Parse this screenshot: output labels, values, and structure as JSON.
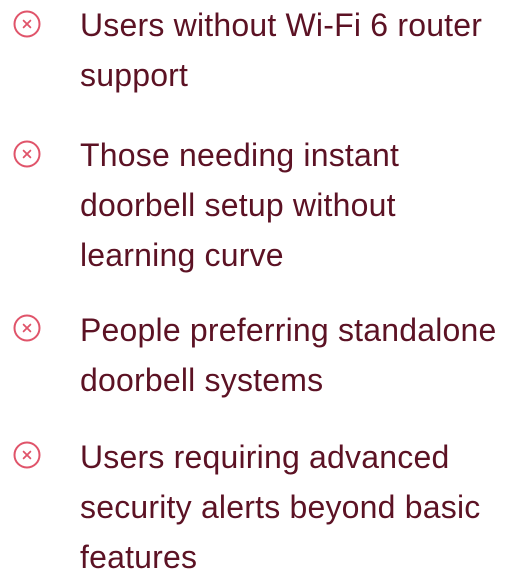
{
  "cons": {
    "icon": "x-circle-icon",
    "icon_color": "#e0546a",
    "text_color": "#5c1224",
    "items": [
      {
        "text": "Users without Wi-Fi 6 router support"
      },
      {
        "text": "Those needing instant doorbell setup without learning curve"
      },
      {
        "text": "People preferring standalone doorbell systems"
      },
      {
        "text": "Users requiring advanced security alerts beyond basic features"
      }
    ]
  }
}
